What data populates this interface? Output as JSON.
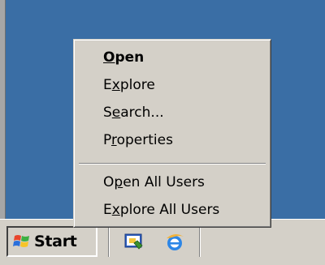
{
  "context_menu": {
    "items": [
      {
        "label_before": "",
        "mnemonic": "O",
        "label_after": "pen",
        "bold": true
      },
      {
        "label_before": "E",
        "mnemonic": "x",
        "label_after": "plore",
        "bold": false
      },
      {
        "label_before": "S",
        "mnemonic": "e",
        "label_after": "arch...",
        "bold": false
      },
      {
        "label_before": "P",
        "mnemonic": "r",
        "label_after": "operties",
        "bold": false
      },
      {
        "label_before": "O",
        "mnemonic": "p",
        "label_after": "en All Users",
        "bold": false
      },
      {
        "label_before": "E",
        "mnemonic": "x",
        "label_after": "plore All Users",
        "bold": false
      }
    ]
  },
  "taskbar": {
    "start_label": "Start",
    "quick_launch": [
      {
        "icon": "show-desktop-icon"
      },
      {
        "icon": "internet-explorer-icon"
      }
    ]
  },
  "colors": {
    "desktop": "#3a6ea5",
    "chrome": "#d4d0c8"
  }
}
